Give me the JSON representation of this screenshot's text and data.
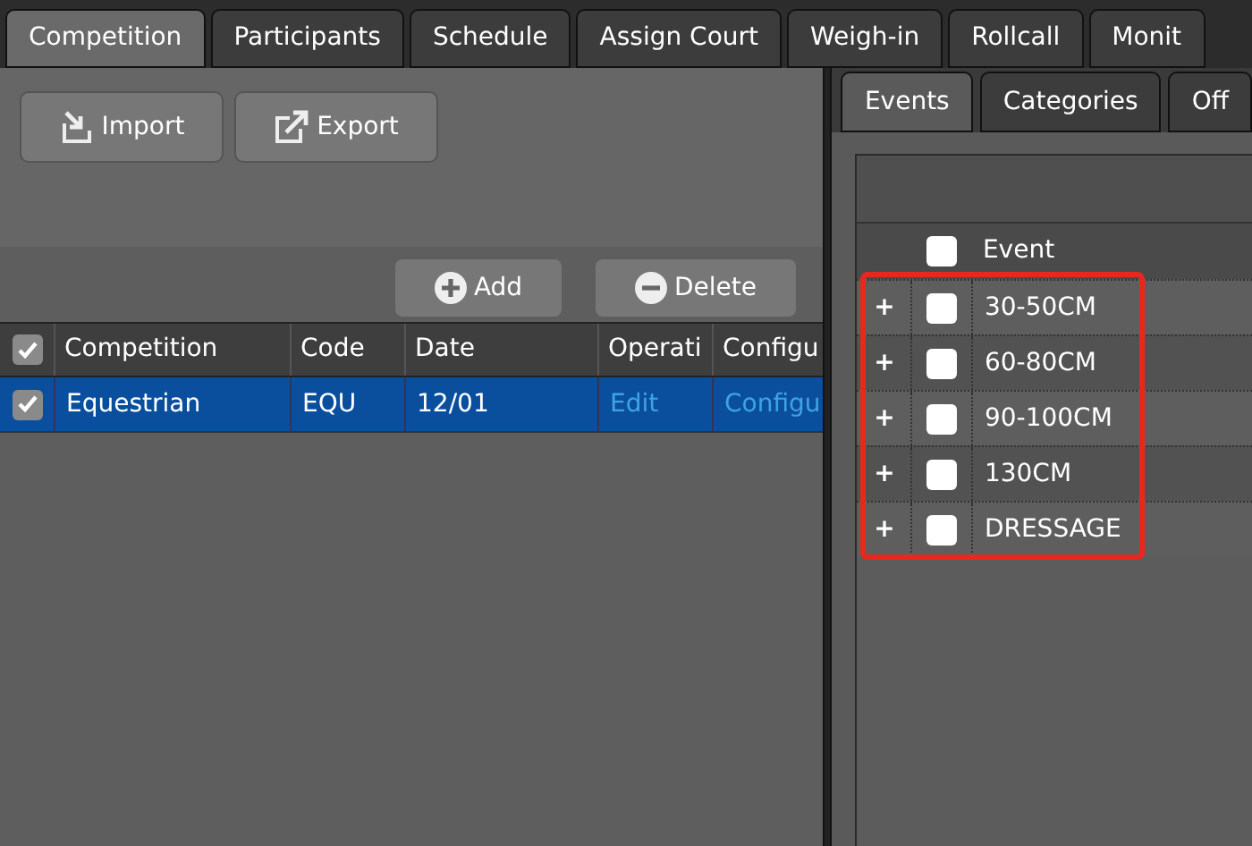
{
  "tabs": [
    {
      "label": "Competition",
      "selected": true
    },
    {
      "label": "Participants",
      "selected": false
    },
    {
      "label": "Schedule",
      "selected": false
    },
    {
      "label": "Assign Court",
      "selected": false
    },
    {
      "label": "Weigh-in",
      "selected": false
    },
    {
      "label": "Rollcall",
      "selected": false
    },
    {
      "label": "Monit",
      "selected": false
    }
  ],
  "toolbar": {
    "buttons": [
      {
        "label": "Import",
        "kind": "import"
      },
      {
        "label": "Export",
        "kind": "export"
      }
    ]
  },
  "actions": [
    {
      "label": "Add",
      "kind": "add"
    },
    {
      "label": "Delete",
      "kind": "delete"
    }
  ],
  "table": {
    "all_checked": true,
    "columns": [
      "Competition",
      "Code",
      "Date",
      "Operati",
      "Configu"
    ],
    "rows": [
      {
        "checked": true,
        "selected": true,
        "cells": [
          "Equestrian",
          "EQU",
          "12/01"
        ],
        "links": [
          "Edit",
          "Configu"
        ]
      }
    ]
  },
  "subtabs": [
    {
      "label": "Events",
      "selected": true
    },
    {
      "label": "Categories",
      "selected": false
    },
    {
      "label": "Off",
      "selected": false
    }
  ],
  "events": {
    "all_checked": false,
    "column": "Event",
    "highlighted": true,
    "rows": [
      {
        "expander": "+",
        "checked": false,
        "name": "30-50CM"
      },
      {
        "expander": "+",
        "checked": false,
        "name": "60-80CM"
      },
      {
        "expander": "+",
        "checked": false,
        "name": "90-100CM"
      },
      {
        "expander": "+",
        "checked": false,
        "name": "130CM"
      },
      {
        "expander": "+",
        "checked": false,
        "name": "DRESSAGE"
      }
    ]
  }
}
